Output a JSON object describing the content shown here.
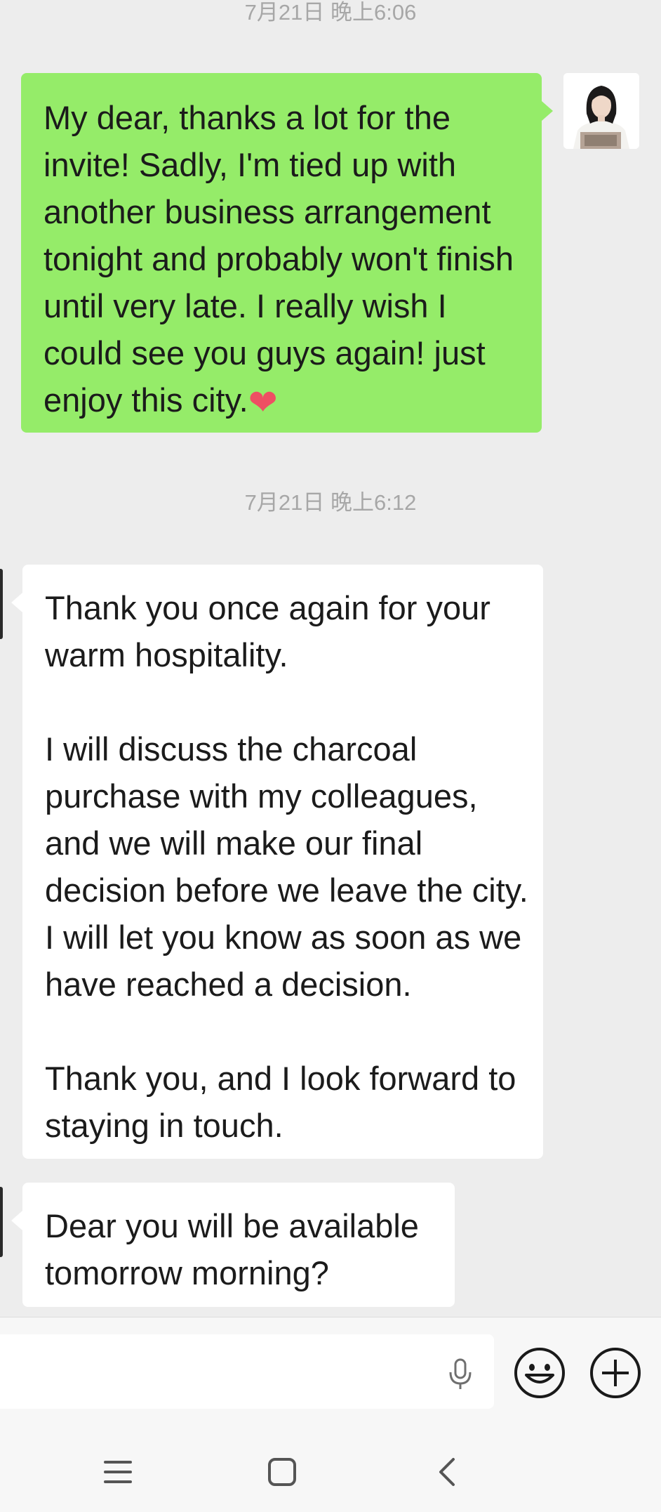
{
  "conversation": {
    "messages": [
      {
        "timestamp": "7月21日 晚上6:06",
        "direction": "sent",
        "text": "My dear, thanks a lot for the invite! Sadly, I'm tied up with another business arrangement tonight and probably won't finish until very late. I really wish I could see you guys again! just enjoy this city.",
        "emoji": "heart-emoji"
      },
      {
        "timestamp": "7月21日 晚上6:12",
        "direction": "received",
        "text": "Thank you once again for your warm hospitality.\n\nI will discuss the charcoal purchase with my colleagues, and we will make our final decision before we leave the city. I will let you know as soon as we have reached a decision.\n\nThank you, and I look forward to staying in touch."
      },
      {
        "direction": "received",
        "text": "Dear you will be available tomorrow morning?"
      }
    ]
  },
  "input_bar": {
    "text_value": "",
    "icons": [
      "microphone-icon",
      "emoji-icon",
      "plus-icon"
    ]
  },
  "nav_bar": {
    "icons": [
      "menu-icon",
      "home-icon",
      "back-icon"
    ]
  },
  "colors": {
    "chat_background": "#ededed",
    "sent_bubble": "#95ec69",
    "received_bubble": "#ffffff",
    "timestamp_text": "#a7a7a7",
    "heart": "#ee4f63"
  }
}
